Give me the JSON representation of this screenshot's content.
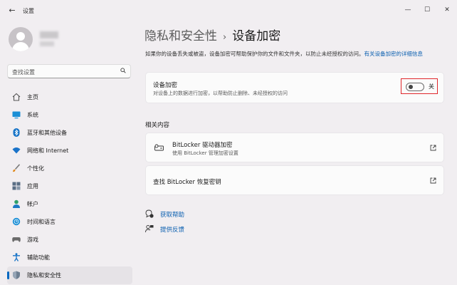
{
  "window": {
    "app_title": "设置",
    "back_icon": "back-arrow-icon",
    "controls": [
      "minimize-icon",
      "maximize-icon",
      "close-icon"
    ]
  },
  "search": {
    "placeholder": "查找设置"
  },
  "sidebar": {
    "items": [
      {
        "label": "主页",
        "icon": "home-icon"
      },
      {
        "label": "系统",
        "icon": "monitor-icon"
      },
      {
        "label": "蓝牙和其他设备",
        "icon": "bluetooth-icon"
      },
      {
        "label": "网络和 Internet",
        "icon": "wifi-icon"
      },
      {
        "label": "个性化",
        "icon": "brush-icon"
      },
      {
        "label": "应用",
        "icon": "apps-icon"
      },
      {
        "label": "帐户",
        "icon": "account-icon"
      },
      {
        "label": "时间和语言",
        "icon": "globe-clock-icon"
      },
      {
        "label": "游戏",
        "icon": "gamepad-icon"
      },
      {
        "label": "辅助功能",
        "icon": "accessibility-icon"
      },
      {
        "label": "隐私和安全性",
        "icon": "shield-icon",
        "selected": true
      }
    ]
  },
  "header": {
    "parent": "隐私和安全性",
    "separator": "›",
    "current": "设备加密"
  },
  "description": {
    "text": "如果你的设备丢失或被盗，设备加密可帮助保护你的文件和文件夹，以防止未经授权的访问。",
    "link": "有关设备加密的详细信息"
  },
  "encryption_card": {
    "title": "设备加密",
    "subtitle": "对设备上的数据进行加密，以帮助防止删除、未经授权的访问",
    "toggle_state": "关",
    "toggle_on": false
  },
  "related": {
    "section_title": "相关内容",
    "items": [
      {
        "title": "BitLocker 驱动器加密",
        "subtitle": "使用 BitLocker 管理加密设置",
        "icon": "bitlocker-key-icon"
      },
      {
        "title": "查找 BitLocker 恢复密钥",
        "subtitle": "",
        "icon": ""
      }
    ]
  },
  "help": {
    "get_help": "获取帮助",
    "feedback": "提供反馈"
  },
  "colors": {
    "accent": "#0067c0",
    "link": "#0a5fb0",
    "highlight_box": "#e0262b"
  }
}
